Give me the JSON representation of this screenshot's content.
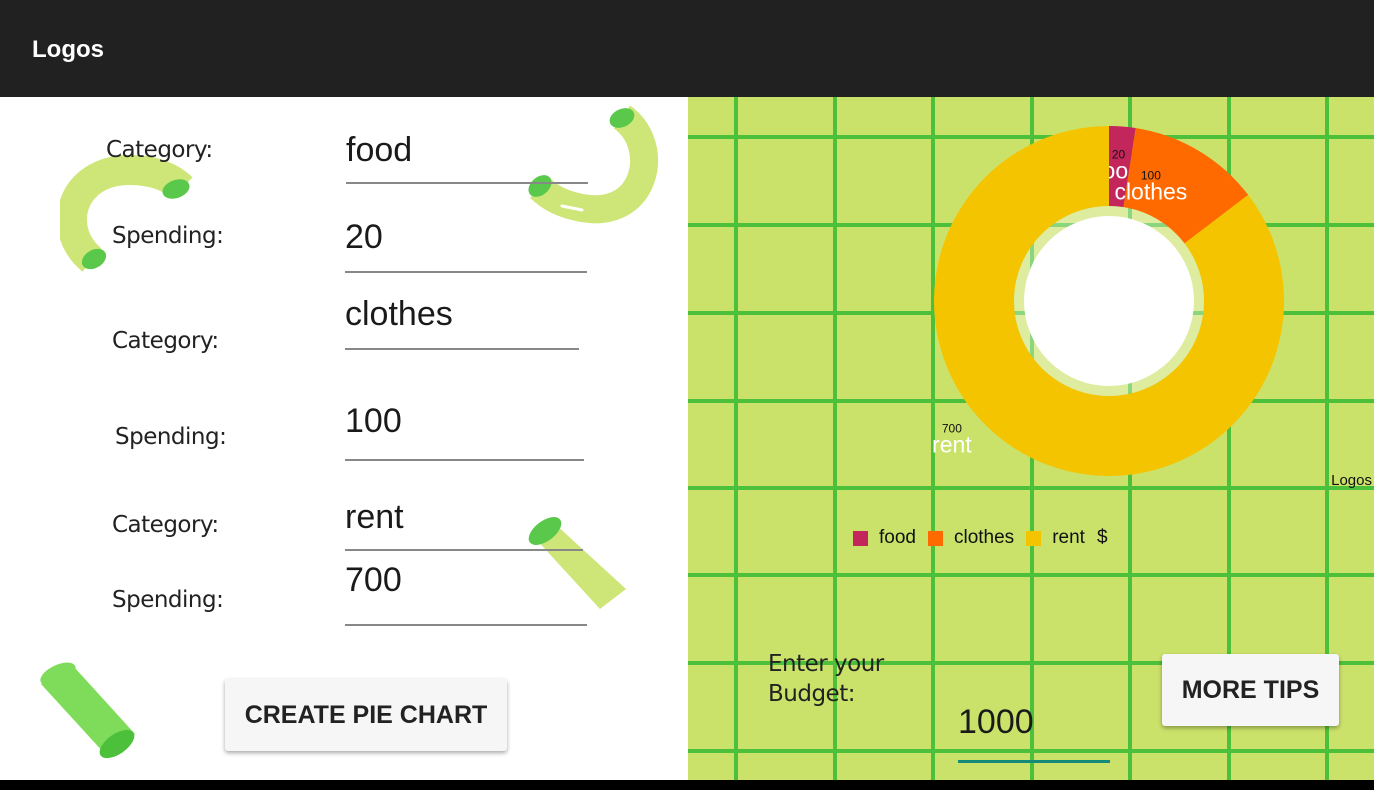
{
  "app": {
    "title": "Logos"
  },
  "form": {
    "rows": [
      {
        "category_label": "Category:",
        "category_value": "food",
        "spending_label": "Spending:",
        "spending_value": "20"
      },
      {
        "category_label": "Category:",
        "category_value": "clothes",
        "spending_label": "Spending:",
        "spending_value": "100"
      },
      {
        "category_label": "Category:",
        "category_value": "rent",
        "spending_label": "Spending:",
        "spending_value": "700"
      }
    ],
    "create_button_label": "CREATE PIE CHART"
  },
  "chart_data": {
    "type": "pie",
    "variant": "donut",
    "categories": [
      "food",
      "clothes",
      "rent"
    ],
    "values": [
      20,
      100,
      700
    ],
    "colors": [
      "#c2265a",
      "#ff6a00",
      "#f5c400"
    ],
    "legend": [
      "food",
      "clothes",
      "rent"
    ],
    "legend_suffix": "$",
    "legend_placement": "bottom-center",
    "watermark": "Logos"
  },
  "budget": {
    "label_line1": "Enter your",
    "label_line2": "Budget:",
    "value": "1000"
  },
  "tips_button_label": "MORE TIPS",
  "colors": {
    "appbar": "#212121",
    "grid_bg": "#cbe26a",
    "grid_line": "#4cc03a",
    "accent_line": "#148a78"
  }
}
